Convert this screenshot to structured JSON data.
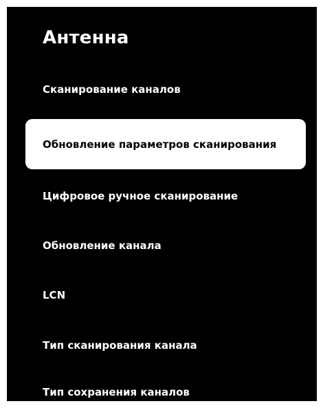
{
  "title": "Антенна",
  "menu": {
    "items": [
      {
        "label": "Сканирование каналов"
      },
      {
        "label": "Обновление параметров сканирования"
      },
      {
        "label": "Цифровое ручное сканирование"
      },
      {
        "label": "Обновление канала"
      },
      {
        "label": "LCN"
      },
      {
        "label": "Тип сканирования канала"
      },
      {
        "label": "Тип сохранения каналов"
      }
    ],
    "selected_index": 1
  },
  "colors": {
    "background": "#000000",
    "text": "#ffffff",
    "highlight_background": "#ffffff",
    "highlight_text": "#000000"
  }
}
